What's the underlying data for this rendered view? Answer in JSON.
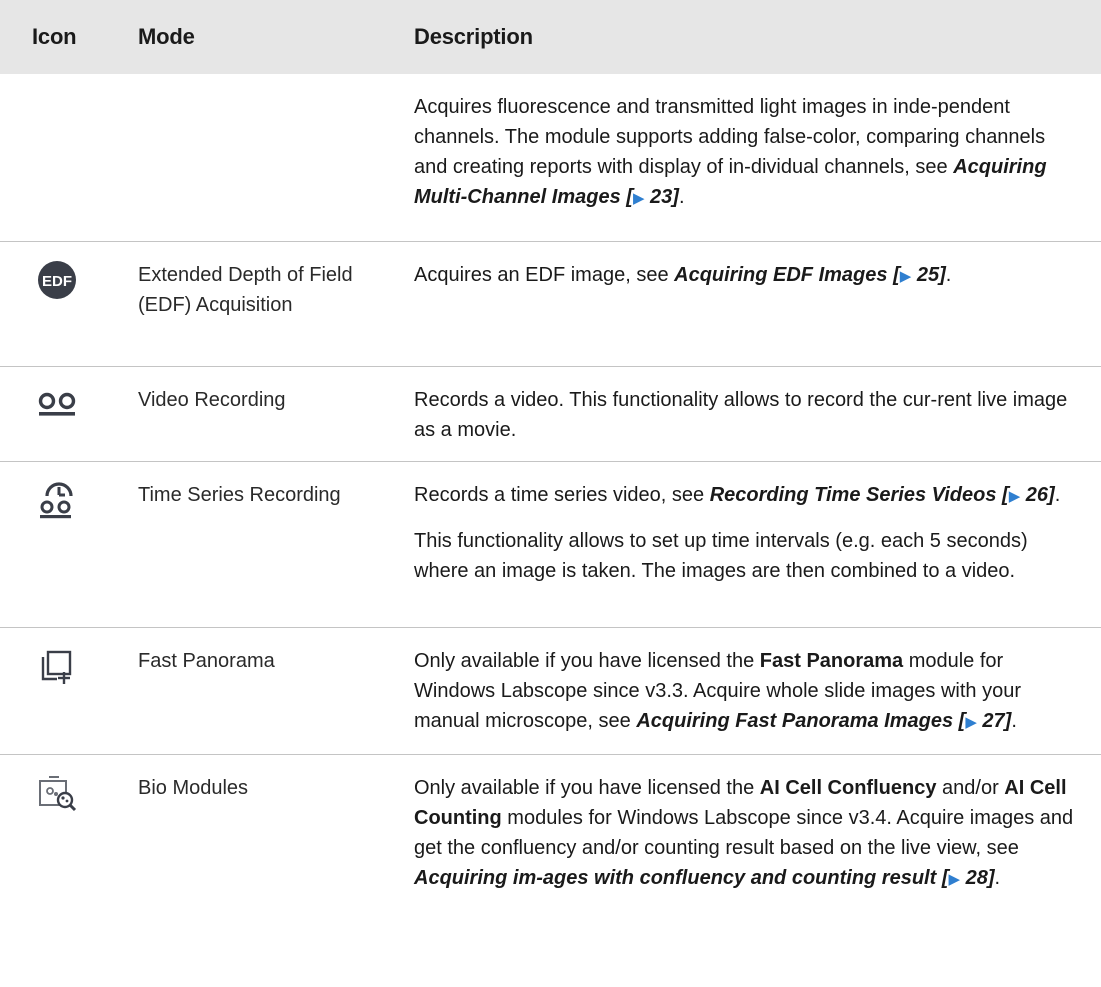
{
  "headers": {
    "icon": "Icon",
    "mode": "Mode",
    "description": "Description"
  },
  "rows": [
    {
      "icon": "",
      "mode": "",
      "desc": [
        {
          "text": "Acquires fluorescence and transmitted light images in inde-pendent channels. The module supports adding false-color, comparing channels and creating reports with display of in-dividual channels, see "
        },
        {
          "ref": "Acquiring Multi-Channel Images"
        },
        {
          "text": " "
        },
        {
          "page": "23"
        },
        {
          "text": "."
        }
      ]
    },
    {
      "icon": "edf-icon",
      "icon_label": "EDF",
      "mode": "Extended Depth of Field (EDF) Acquisition",
      "desc": [
        {
          "text": "Acquires an EDF image, see "
        },
        {
          "ref": "Acquiring EDF Images"
        },
        {
          "text": " "
        },
        {
          "page": "25"
        },
        {
          "text": "."
        }
      ]
    },
    {
      "icon": "video-recording-icon",
      "mode": "Video Recording",
      "desc": [
        {
          "text": "Records a video. This functionality allows to record the cur-rent live image as a movie."
        }
      ]
    },
    {
      "icon": "time-series-recording-icon",
      "mode": "Time Series Recording",
      "desc": [
        {
          "text": "Records a time series video, see "
        },
        {
          "ref": "Recording Time Series Videos"
        },
        {
          "text": " "
        },
        {
          "page": "26"
        },
        {
          "text": "."
        }
      ],
      "desc2": [
        {
          "text": "This functionality allows to set up time intervals (e.g. each 5 seconds) where an image is taken. The images are then combined to a video."
        }
      ]
    },
    {
      "icon": "fast-panorama-icon",
      "mode": "Fast Panorama",
      "desc": [
        {
          "text": "Only available if you have licensed the "
        },
        {
          "bold": "Fast Panorama"
        },
        {
          "text": " module for Windows Labscope since v3.3. Acquire whole slide images with your manual microscope, see "
        },
        {
          "ref": "Acquiring Fast Panorama Images"
        },
        {
          "text": " "
        },
        {
          "page": "27"
        },
        {
          "text": "."
        }
      ]
    },
    {
      "icon": "bio-modules-icon",
      "mode": "Bio Modules",
      "desc": [
        {
          "text": "Only available if you have licensed the "
        },
        {
          "bold": "AI Cell Confluency"
        },
        {
          "text": " and/or "
        },
        {
          "bold": "AI Cell Counting"
        },
        {
          "text": " modules for Windows Labscope since v3.4. Acquire images and get the confluency and/or counting result based on the live view, see "
        },
        {
          "ref": "Acquiring im-ages with confluency and counting result"
        },
        {
          "text": " "
        },
        {
          "page": "28"
        },
        {
          "text": "."
        }
      ]
    }
  ]
}
